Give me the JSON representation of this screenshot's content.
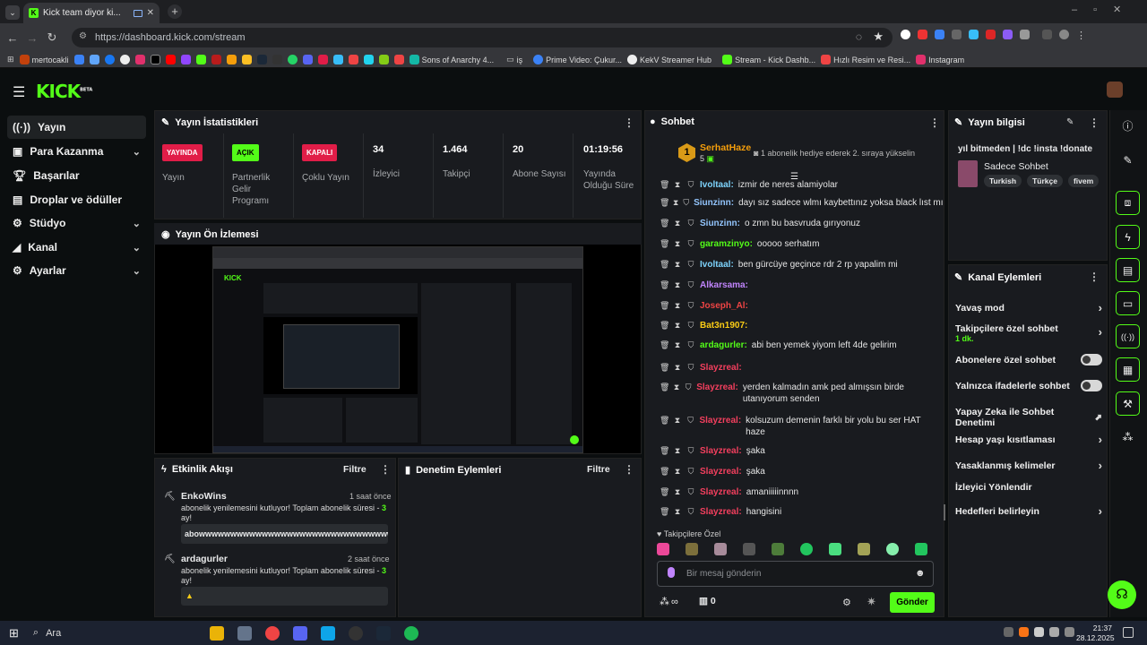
{
  "browser": {
    "tab_title": "Kick team diyor ki...",
    "url": "https://dashboard.kick.com/stream",
    "bookmarks": [
      "mertocakli",
      "Sons of Anarchy 4...",
      "iş",
      "Prime Video: Çukur...",
      "KekV Streamer Hub",
      "Stream - Kick Dashb...",
      "Hızlı Resim ve Resi...",
      "Instagram"
    ]
  },
  "brand": {
    "logo": "KICK",
    "beta": "BETA",
    "accent": "#53fc18"
  },
  "sidebar": [
    {
      "label": "Yayın",
      "icon": "broadcast-icon",
      "active": true
    },
    {
      "label": "Para Kazanma",
      "icon": "money-icon",
      "chevron": true
    },
    {
      "label": "Başarılar",
      "icon": "trophy-icon"
    },
    {
      "label": "Droplar ve ödüller",
      "icon": "gift-icon"
    },
    {
      "label": "Stüdyo",
      "icon": "gear-icon",
      "chevron": true
    },
    {
      "label": "Kanal",
      "icon": "megaphone-icon",
      "chevron": true
    },
    {
      "label": "Ayarlar",
      "icon": "settings-icon",
      "chevron": true
    }
  ],
  "stats": {
    "title": "Yayın İstatistikleri",
    "items": [
      {
        "badge": "YAYINDA",
        "label": "Yayın"
      },
      {
        "badge": "AÇIK",
        "label": "Partnerlik Gelir Programı"
      },
      {
        "badge": "KAPALI",
        "label": "Çoklu Yayın"
      },
      {
        "value": "34",
        "label": "İzleyici"
      },
      {
        "value": "1.464",
        "label": "Takipçi"
      },
      {
        "value": "20",
        "label": "Abone Sayısı"
      },
      {
        "value": "01:19:56",
        "label": "Yayında Olduğu Süre"
      }
    ]
  },
  "preview": {
    "title": "Yayın Ön İzlemesi"
  },
  "activity": {
    "title": "Etkinlik Akışı",
    "filter": "Filtre",
    "events": [
      {
        "user": "EnkoWins",
        "time": "1 saat önce",
        "text_a": "abonelik yenilemesini kutluyor! Toplam abonelik süresi - ",
        "num": "3",
        "text_b": "ay!",
        "msg": "abowwwwwwwwwwwwwwwwwwwwwwwwwwwwwwwwwwwwwwwwwwwwww"
      },
      {
        "user": "ardagurler",
        "time": "2 saat önce",
        "text_a": "abonelik yenilemesini kutluyor! Toplam abonelik süresi - ",
        "num": "3",
        "text_b": "ay!",
        "msg": ""
      }
    ]
  },
  "moderation": {
    "title": "Denetim Eylemleri",
    "filter": "Filtre"
  },
  "chat": {
    "title": "Sohbet",
    "pinned": {
      "rank": "1",
      "user": "SerhatHaze",
      "count": "5",
      "text": "1 abonelik hediye ederek 2. sıraya yükselin"
    },
    "messages": [
      {
        "user": "Ivoltaal",
        "text": "izmir de neres alamiyolar",
        "color": "#7dd3fc"
      },
      {
        "user": "Siunzinn",
        "text": "dayı sız sadece wlmı kaybettınız yoksa black lıst mı",
        "color": "#93c5fd"
      },
      {
        "user": "Siunzinn",
        "text": "o zmn bu basvruda gırıyonuz",
        "color": "#93c5fd"
      },
      {
        "user": "garamzinyo",
        "text": "ooooo serhatım",
        "color": "#53fc18"
      },
      {
        "user": "Ivoltaal",
        "text": "ben gürcüye geçince rdr 2 rp yapalim mi",
        "color": "#7dd3fc"
      },
      {
        "user": "Alkarsama",
        "text": "",
        "color": "#c084fc"
      },
      {
        "user": "Joseph_Al",
        "text": "",
        "color": "#ef4444"
      },
      {
        "user": "Bat3n1907",
        "text": "",
        "color": "#facc15"
      },
      {
        "user": "ardagurler",
        "text": "abi ben yemek yiyom left 4de gelirim",
        "color": "#53fc18"
      },
      {
        "user": "Slayzreal",
        "text": "",
        "color": "#f43f5e"
      },
      {
        "user": "Slayzreal",
        "text": "yerden kalmadın amk ped almışsın birde utanıyorum senden",
        "color": "#f43f5e"
      },
      {
        "user": "Slayzreal",
        "text": "kolsuzum demenin farklı bir yolu bu ser HAT haze",
        "color": "#f43f5e"
      },
      {
        "user": "Slayzreal",
        "text": "şaka",
        "color": "#f43f5e"
      },
      {
        "user": "Slayzreal",
        "text": "şaka",
        "color": "#f43f5e"
      },
      {
        "user": "Slayzreal",
        "text": "amaniiiiinnnn",
        "color": "#f43f5e"
      },
      {
        "user": "Slayzreal",
        "text": "hangisini",
        "color": "#f43f5e"
      }
    ],
    "emote_title": "Takipçilere Özel",
    "placeholder": "Bir mesaj gönderin",
    "infinity": "∞",
    "points": "0",
    "send": "Gönder"
  },
  "info": {
    "title": "Yayın bilgisi",
    "stream_title": "yıl bitmeden | !dc !insta !donate",
    "category": "Sadece Sohbet",
    "tags": [
      "Turkish",
      "Türkçe",
      "fivem"
    ]
  },
  "actions": {
    "title": "Kanal Eylemleri",
    "items": [
      {
        "label": "Yavaş mod",
        "kind": "arrow"
      },
      {
        "label": "Takipçilere özel sohbet",
        "sub": "1 dk.",
        "kind": "arrow"
      },
      {
        "label": "Abonelere özel sohbet",
        "kind": "toggle"
      },
      {
        "label": "Yalnızca ifadelerle sohbet",
        "kind": "toggle"
      },
      {
        "label": "Yapay Zeka ile Sohbet Denetimi",
        "kind": "external"
      },
      {
        "label": "Hesap yaşı kısıtlaması",
        "kind": "arrow"
      },
      {
        "label": "Yasaklanmış kelimeler",
        "kind": "arrow"
      },
      {
        "label": "İzleyici Yönlendir",
        "kind": "none"
      },
      {
        "label": "Hedefleri belirleyin",
        "kind": "arrow"
      }
    ]
  },
  "taskbar": {
    "search": "Ara",
    "time": "21:37",
    "date": "28.12.2025"
  }
}
